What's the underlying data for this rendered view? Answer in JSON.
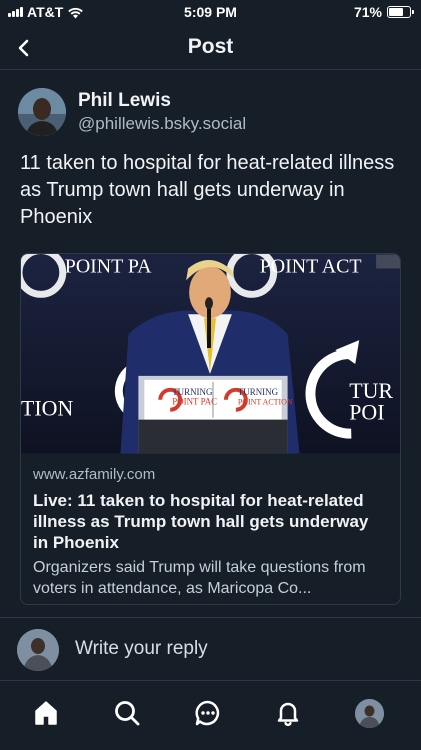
{
  "status_bar": {
    "carrier": "AT&T",
    "time": "5:09 PM",
    "battery_text": "71%",
    "battery_level": 0.71
  },
  "header": {
    "title": "Post",
    "back_icon": "chevron-left-icon"
  },
  "post": {
    "author_name": "Phil Lewis",
    "author_handle": "@phillewis.bsky.social",
    "text": "11 taken to hospital for heat-related illness as Trump town hall gets underway in Phoenix",
    "link_card": {
      "domain": "www.azfamily.com",
      "title": "Live: 11 taken to hospital for heat-related illness as Trump town hall gets underway in Phoenix",
      "description": "Organizers said Trump will take questions from voters in attendance, as Maricopa Co...",
      "image_texts": {
        "banner_left": "POINT PA",
        "banner_right": "POINT ACT",
        "side_left": "TION",
        "side_right_1": "TUR",
        "side_right_2": "POI",
        "podium_left_1": "TURNING",
        "podium_left_2": "POINT PAC",
        "podium_right_1": "TURNING",
        "podium_right_2": "POINT ACTION"
      }
    }
  },
  "reply": {
    "placeholder": "Write your reply"
  },
  "tab_bar": {
    "items": [
      {
        "name": "home",
        "icon": "home-icon",
        "active": true
      },
      {
        "name": "search",
        "icon": "search-icon"
      },
      {
        "name": "chat",
        "icon": "chat-icon"
      },
      {
        "name": "notifications",
        "icon": "bell-icon"
      },
      {
        "name": "profile",
        "icon": "profile-avatar"
      }
    ]
  },
  "colors": {
    "background": "#161e27",
    "border": "#2c3845",
    "text_primary": "#f1f3f5",
    "text_secondary": "#aebbc9"
  }
}
